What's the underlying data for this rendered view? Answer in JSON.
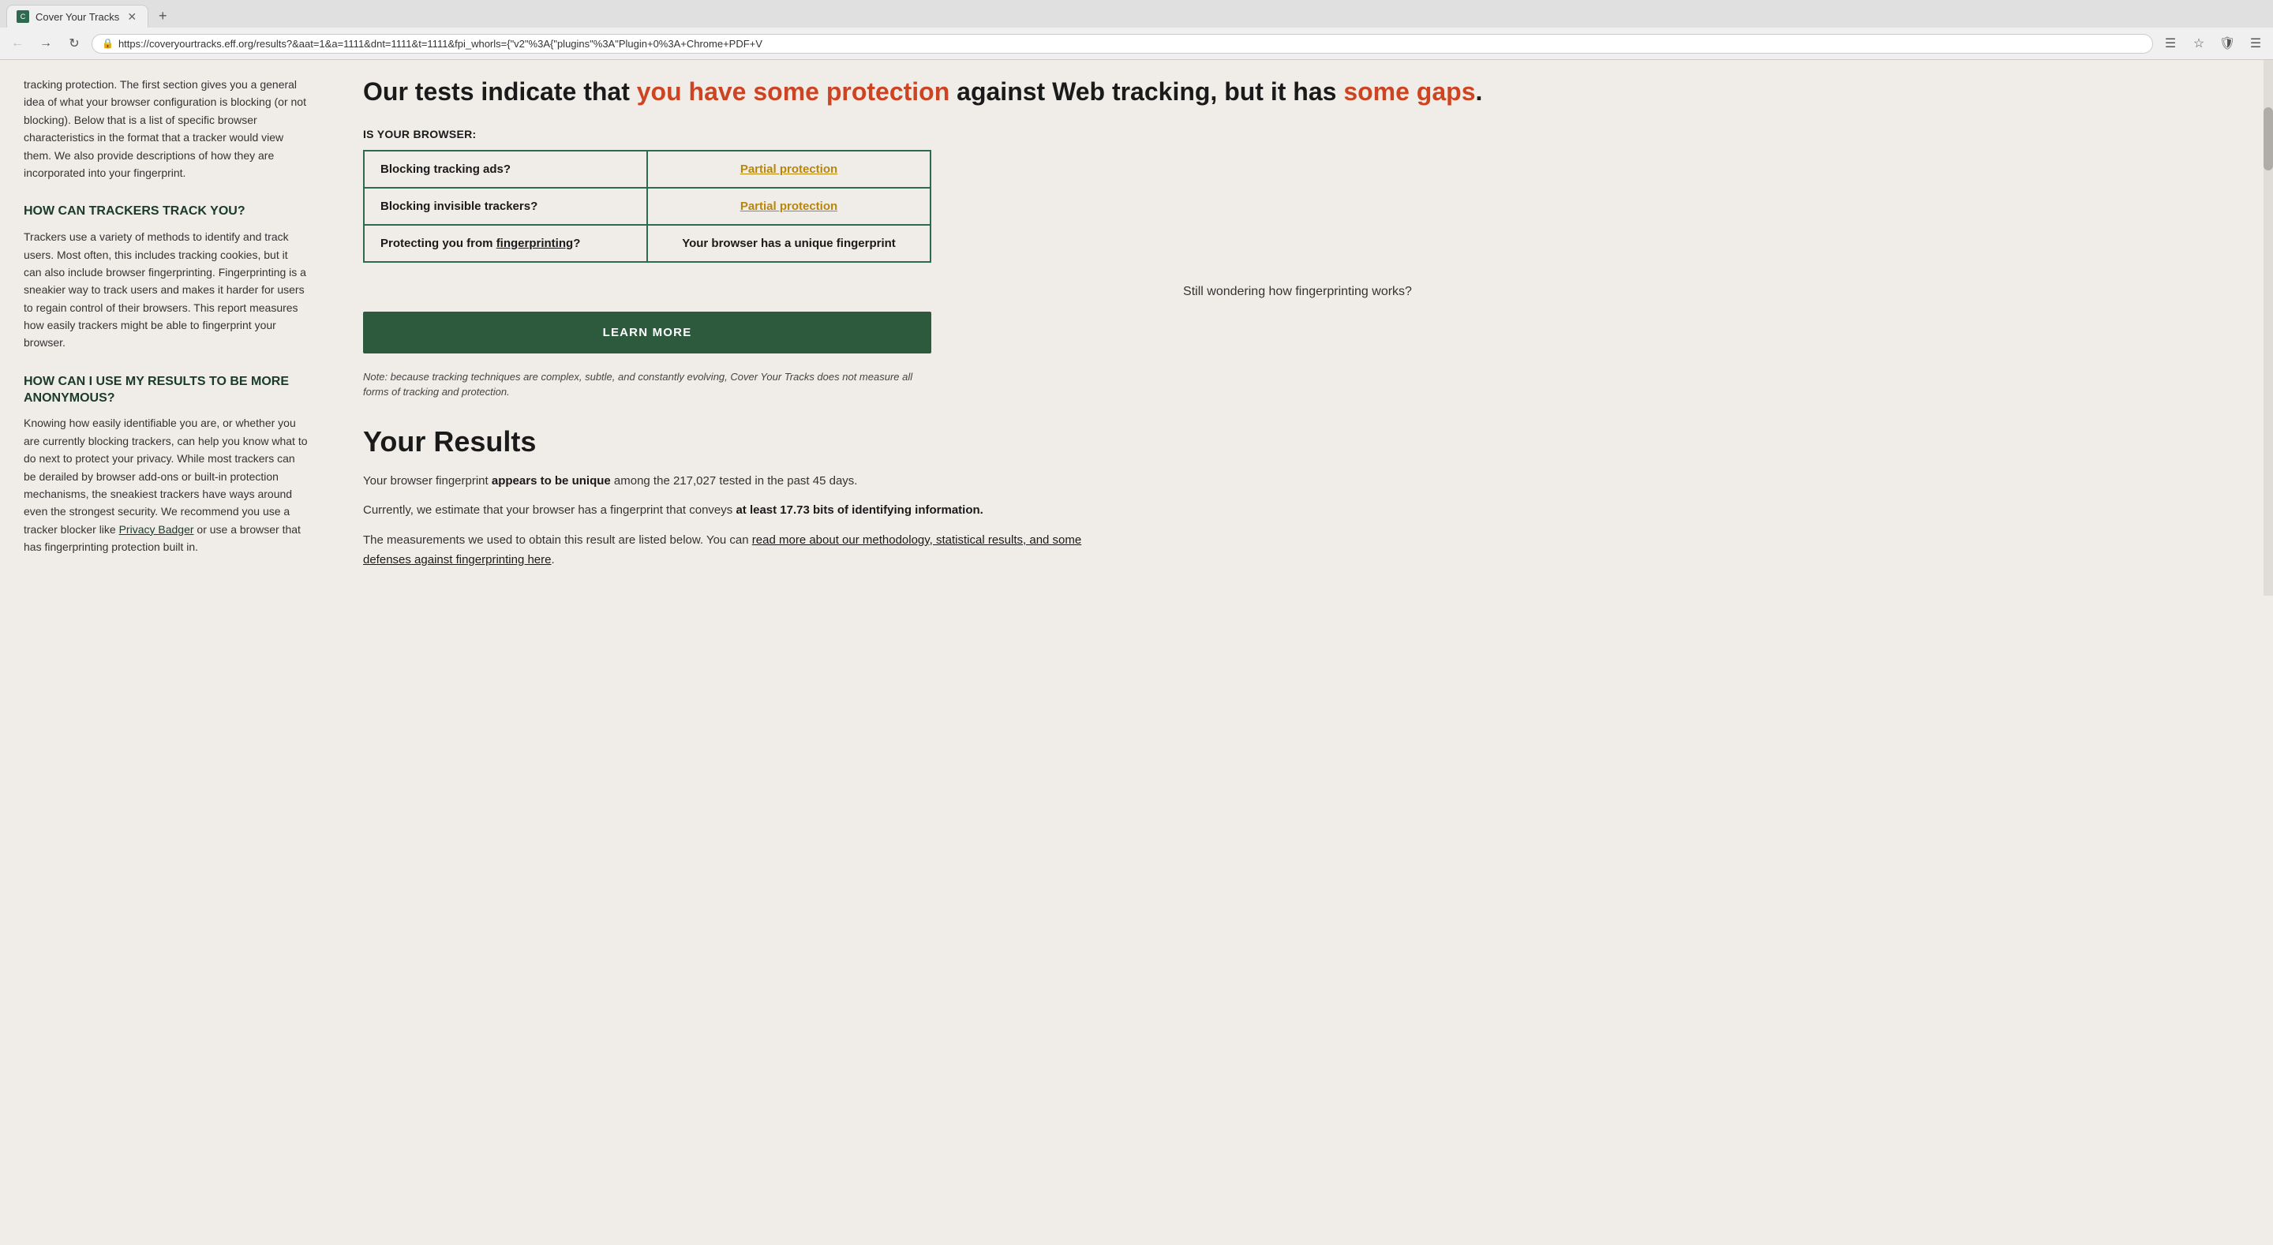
{
  "browser": {
    "tab_title": "Cover Your Tracks",
    "url_display": "https://coveryourtracks.eff.org/results?&aat=1&a=1111&dnt=1111&t=1111&fpi_whorls={\"v2\"%3A{\"plugins\"%3A\"Plugin+0%3A+Chrome+PDF+V",
    "url_short": "https://coveryourtracks.eff.org/results?&aat=1&a=1111&dnt=1111&t=1111&fpi_whorls={\"v2\"%3A{\"plugins\"%3A\"Plugin+0%3A+Chrome+PDF+V"
  },
  "sidebar": {
    "intro_text": "tracking protection. The first section gives you a general idea of what your browser configuration is blocking (or not blocking). Below that is a list of specific browser characteristics in the format that a tracker would view them. We also provide descriptions of how they are incorporated into your fingerprint.",
    "section1_heading": "HOW CAN TRACKERS TRACK YOU?",
    "section1_text": "Trackers use a variety of methods to identify and track users. Most often, this includes tracking cookies, but it can also include browser fingerprinting. Fingerprinting is a sneakier way to track users and makes it harder for users to regain control of their browsers. This report measures how easily trackers might be able to fingerprint your browser.",
    "section2_heading": "HOW CAN I USE MY RESULTS TO BE MORE ANONYMOUS?",
    "section2_text_1": "Knowing how easily identifiable you are, or whether you are currently blocking trackers, can help you know what to do next to protect your privacy. While most trackers can be derailed by browser add-ons or built-in protection mechanisms, the sneakiest trackers have ways around even the strongest security. We recommend you use a tracker blocker like ",
    "section2_link": "Privacy Badger",
    "section2_text_2": " or use a browser that has fingerprinting protection built in."
  },
  "main": {
    "headline_part1": "Our tests indicate that ",
    "headline_part2": "you have ",
    "headline_highlight1": "some protection",
    "headline_part3": " against Web tracking, but it has ",
    "headline_highlight2": "some gaps",
    "headline_end": ".",
    "is_your_browser_label": "IS YOUR BROWSER:",
    "table_rows": [
      {
        "label": "Blocking tracking ads?",
        "value": "Partial protection",
        "value_class": "partial"
      },
      {
        "label": "Blocking invisible trackers?",
        "value": "Partial protection",
        "value_class": "partial"
      },
      {
        "label_part1": "Protecting you from ",
        "label_link": "fingerprinting",
        "label_part2": "?",
        "value": "Your browser has a unique fingerprint",
        "value_class": "unique"
      }
    ],
    "fingerprint_question": "Still wondering how fingerprinting works?",
    "learn_more_label": "LEARN MORE",
    "note_text": "Note: because tracking techniques are complex, subtle, and constantly evolving, Cover Your Tracks does not measure all forms of tracking and protection.",
    "your_results_heading": "Your Results",
    "results_para1_part1": "Your browser fingerprint ",
    "results_para1_bold": "appears to be unique",
    "results_para1_part2": " among the 217,027 tested in the past 45 days.",
    "results_para2_part1": "Currently, we estimate that your browser has a fingerprint that conveys ",
    "results_para2_bold": "at least 17.73 bits of identifying information.",
    "results_para3_part1": "The measurements we used to obtain this result are listed below. You can ",
    "results_para3_link": "read more about our methodology, statistical results, and some defenses against fingerprinting here",
    "results_para3_end": "."
  }
}
